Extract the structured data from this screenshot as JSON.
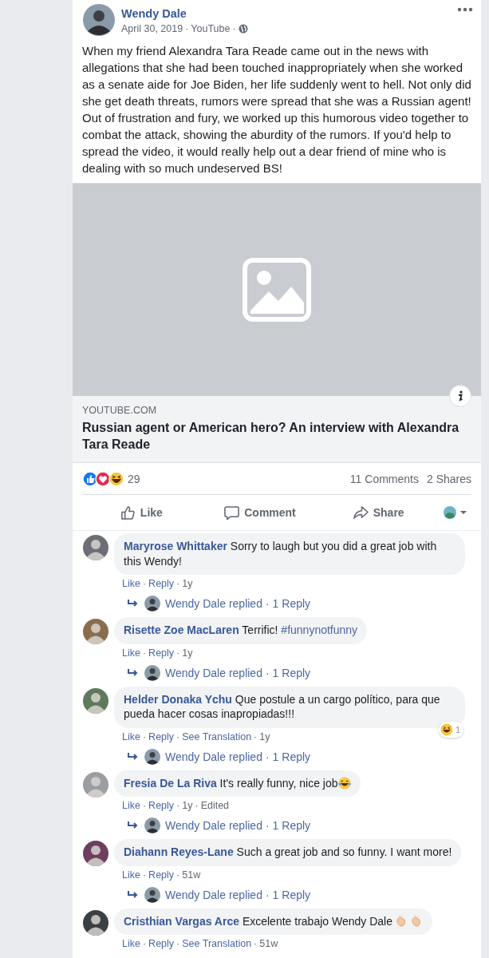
{
  "separator": "·",
  "post": {
    "author": "Wendy Dale",
    "date": "April 30, 2019",
    "source": "YouTube",
    "text": "When my friend Alexandra Tara Reade came out in the news with allegations that she had been touched inappropriately when she worked as a senate aide for Joe Biden, her life suddenly went to hell. Not only did she get death threats, rumors were spread that she was a Russian agent! Out of frustration and fury, we worked up this humorous video together to combat the attack, showing the aburdity of the rumors. If you'd help to spread the video, it would really help out a dear friend of mine who is dealing with so much undeserved BS!"
  },
  "link_preview": {
    "domain": "YOUTUBE.COM",
    "title": "Russian agent or American hero? An interview with Alexandra Tara Reade"
  },
  "reactions": {
    "count": "29",
    "comments": "11 Comments",
    "shares": "2 Shares"
  },
  "actions": [
    {
      "kind": "like",
      "label": "Like"
    },
    {
      "kind": "comment",
      "label": "Comment"
    },
    {
      "kind": "share",
      "label": "Share"
    }
  ],
  "comments": [
    {
      "author": "Maryrose Whittaker",
      "text": "Sorry to laugh but you did a great job with this Wendy!",
      "meta": [
        {
          "kind": "link",
          "label": "Like"
        },
        {
          "kind": "link",
          "label": "Reply"
        },
        {
          "kind": "info",
          "label": "1y"
        }
      ],
      "reply": {
        "label": "Wendy Dale replied",
        "count": "1 Reply"
      }
    },
    {
      "author": "Risette Zoe MacLaren",
      "text": "Terrific!",
      "hashtag": "#funnynotfunny",
      "meta": [
        {
          "kind": "link",
          "label": "Like"
        },
        {
          "kind": "link",
          "label": "Reply"
        },
        {
          "kind": "info",
          "label": "1y"
        }
      ],
      "reply": {
        "label": "Wendy Dale replied",
        "count": "1 Reply"
      }
    },
    {
      "author": "Helder Donaka Ychu",
      "text": "Que postule a un cargo político, para que pueda hacer cosas inapropiadas!!!",
      "reaction_count": "1",
      "meta": [
        {
          "kind": "link",
          "label": "Like"
        },
        {
          "kind": "link",
          "label": "Reply"
        },
        {
          "kind": "link",
          "label": "See Translation"
        },
        {
          "kind": "info",
          "label": "1y"
        }
      ],
      "reply": {
        "label": "Wendy Dale replied",
        "count": "1 Reply"
      }
    },
    {
      "author": "Fresia De La Riva",
      "text": "It's really funny, nice job",
      "trailing_icons": [
        {
          "kind": "tears"
        }
      ],
      "meta": [
        {
          "kind": "link",
          "label": "Like"
        },
        {
          "kind": "link",
          "label": "Reply"
        },
        {
          "kind": "info",
          "label": "1y"
        },
        {
          "kind": "info",
          "label": "Edited"
        }
      ],
      "reply": {
        "label": "Wendy Dale replied",
        "count": "1 Reply"
      }
    },
    {
      "author": "Diahann Reyes-Lane",
      "text": "Such a great job and so funny. I want more!",
      "meta": [
        {
          "kind": "link",
          "label": "Like"
        },
        {
          "kind": "link",
          "label": "Reply"
        },
        {
          "kind": "info",
          "label": "51w"
        }
      ],
      "reply": {
        "label": "Wendy Dale replied",
        "count": "1 Reply"
      }
    },
    {
      "author": "Cristhian Vargas Arce",
      "text": "Excelente trabajo Wendy Dale",
      "trailing_icons": [
        {
          "kind": "clap"
        },
        {
          "kind": "clap"
        }
      ],
      "meta": [
        {
          "kind": "link",
          "label": "Like"
        },
        {
          "kind": "link",
          "label": "Reply"
        },
        {
          "kind": "link",
          "label": "See Translation"
        },
        {
          "kind": "info",
          "label": "51w"
        }
      ]
    }
  ]
}
